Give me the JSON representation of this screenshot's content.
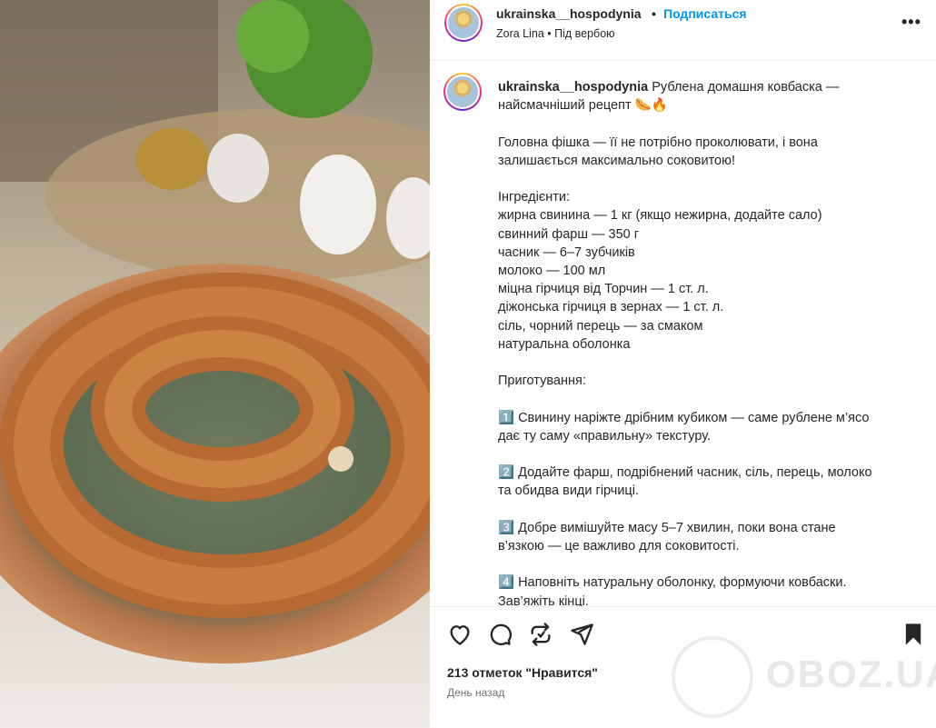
{
  "header": {
    "username": "ukrainska__hospodynia",
    "separator": "•",
    "follow_label": "Подписаться",
    "subtitle": "Zora Lina • Під вербою",
    "more_label": "•••"
  },
  "caption": {
    "username": "ukrainska__hospodynia",
    "text": " Рублена домашня ковбаска —\nнайсмачніший рецепт 🌭🔥\n\nГоловна фішка — її не потрібно проколювати, і вона\nзалишається максимально соковитою!\n\nІнгредієнти:\nжирна свинина — 1 кг (якщо нежирна, додайте сало)\nсвинний фарш — 350 г\nчасник — 6–7 зубчиків\nмолоко — 100 мл\nміцна гірчиця від Торчин — 1 ст. л.\nдіжонська гірчиця в зернах — 1 ст. л.\nсіль, чорний перець — за смаком\nнатуральна оболонка\n\nПриготування:\n\n1️⃣ Свинину наріжте дрібним кубиком — саме рублене м’ясо\nдає ту саму «правильну» текстуру.\n\n2️⃣ Додайте фарш, подрібнений часник, сіль, перець, молоко\nта обидва види гірчиці.\n\n3️⃣ Добре вимішуйте масу 5–7 хвилин, поки вона стане\nв’язкою — це важливо для соковитості.\n\n4️⃣ Наповніть натуральну оболонку, формуючи ковбаски.\nЗав’яжіть кінці."
  },
  "footer": {
    "likes": "213 отметок \"Нравится\"",
    "time": "День назад",
    "watermark": "OBOZ.UA"
  },
  "icons": [
    "heart-icon",
    "comment-icon",
    "repost-icon",
    "share-icon",
    "bookmark-icon"
  ]
}
